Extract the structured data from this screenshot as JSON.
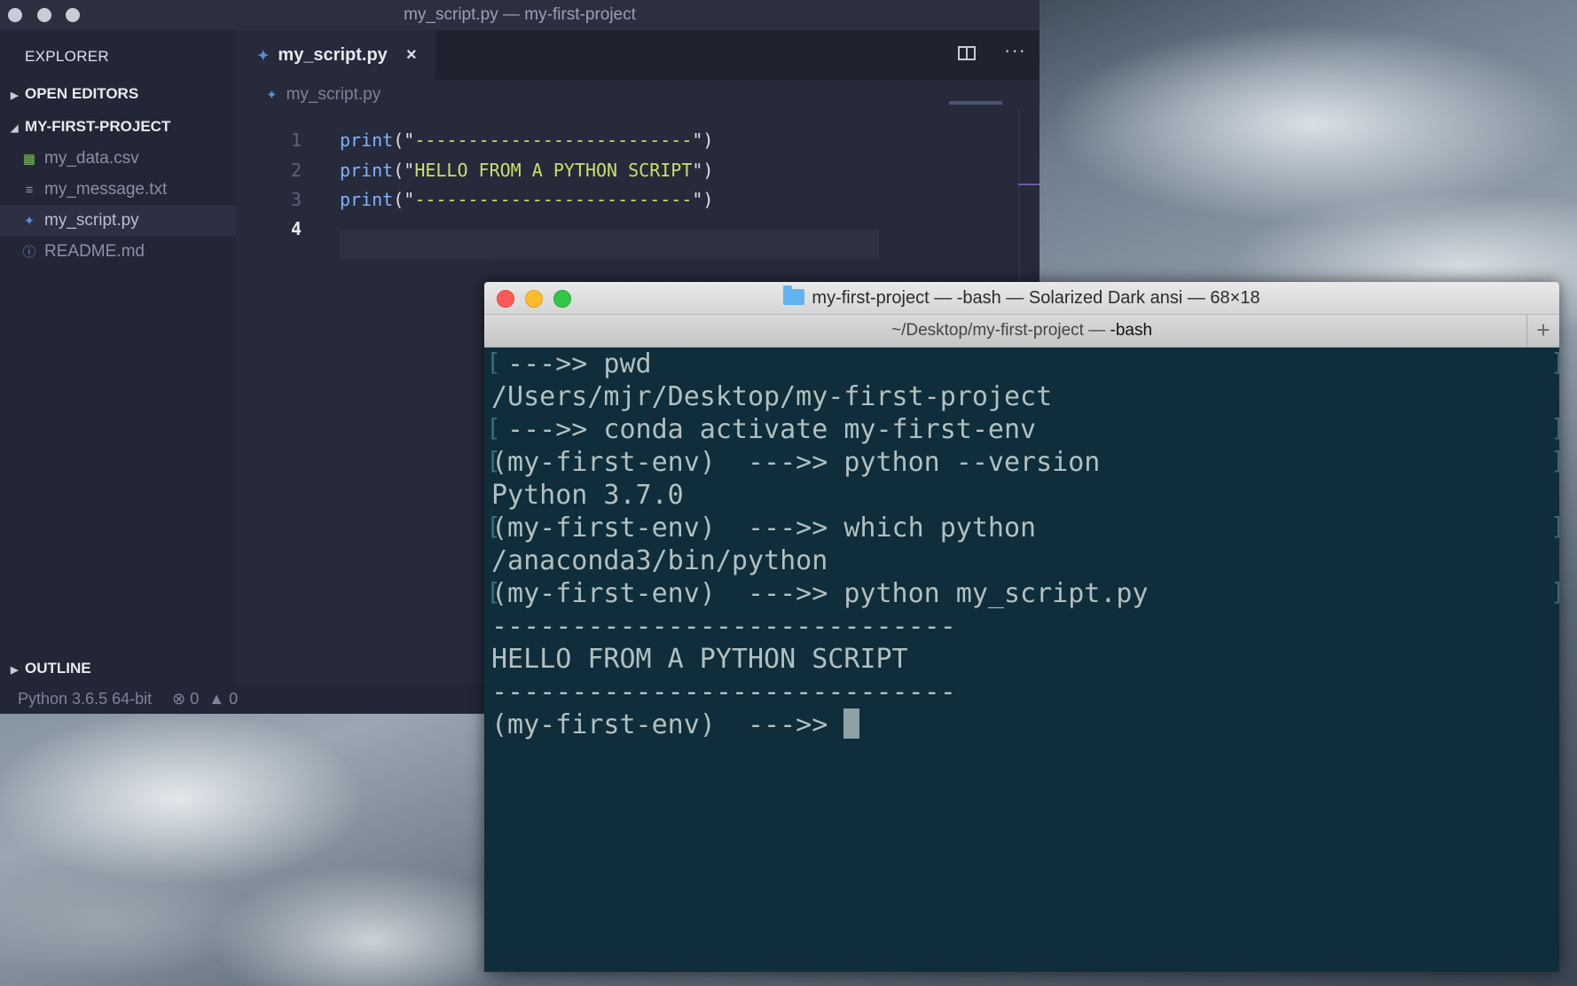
{
  "vscode": {
    "title": "my_script.py — my-first-project",
    "sidebar": {
      "header": "EXPLORER",
      "open_editors": "OPEN EDITORS",
      "project": "MY-FIRST-PROJECT",
      "files": [
        {
          "name": "my_data.csv",
          "icon": "table-icon"
        },
        {
          "name": "my_message.txt",
          "icon": "text-lines-icon"
        },
        {
          "name": "my_script.py",
          "icon": "python-icon"
        },
        {
          "name": "README.md",
          "icon": "info-icon"
        }
      ],
      "outline": "OUTLINE"
    },
    "tab": {
      "label": "my_script.py",
      "close": "×"
    },
    "breadcrumb": "my_script.py",
    "code": [
      {
        "n": "1",
        "fn": "print",
        "open": "(\"",
        "str": "--------------------------",
        "close": "\")"
      },
      {
        "n": "2",
        "fn": "print",
        "open": "(\"",
        "str": "HELLO FROM A PYTHON SCRIPT",
        "close": "\")"
      },
      {
        "n": "3",
        "fn": "print",
        "open": "(\"",
        "str": "--------------------------",
        "close": "\")"
      },
      {
        "n": "4",
        "fn": "",
        "open": "",
        "str": "",
        "close": ""
      }
    ],
    "status": {
      "python": "Python 3.6.5 64-bit",
      "errors": "0",
      "warnings": "0"
    }
  },
  "terminal": {
    "title": "my-first-project — -bash — Solarized Dark ansi — 68×18",
    "tab_path": "~/Desktop/my-first-project — ",
    "tab_bold": "-bash",
    "lines": [
      " --->> pwd",
      "/Users/mjr/Desktop/my-first-project",
      " --->> conda activate my-first-env",
      "(my-first-env)  --->> python --version",
      "Python 3.7.0",
      "(my-first-env)  --->> which python",
      "/anaconda3/bin/python",
      "(my-first-env)  --->> python my_script.py",
      "-----------------------------",
      "HELLO FROM A PYTHON SCRIPT",
      "-----------------------------",
      "(my-first-env)  --->> "
    ]
  },
  "colors": {
    "accent_keyword": "#7fb3ff",
    "string": "#c8e06a",
    "terminal_bg": "#0f2d3a"
  }
}
